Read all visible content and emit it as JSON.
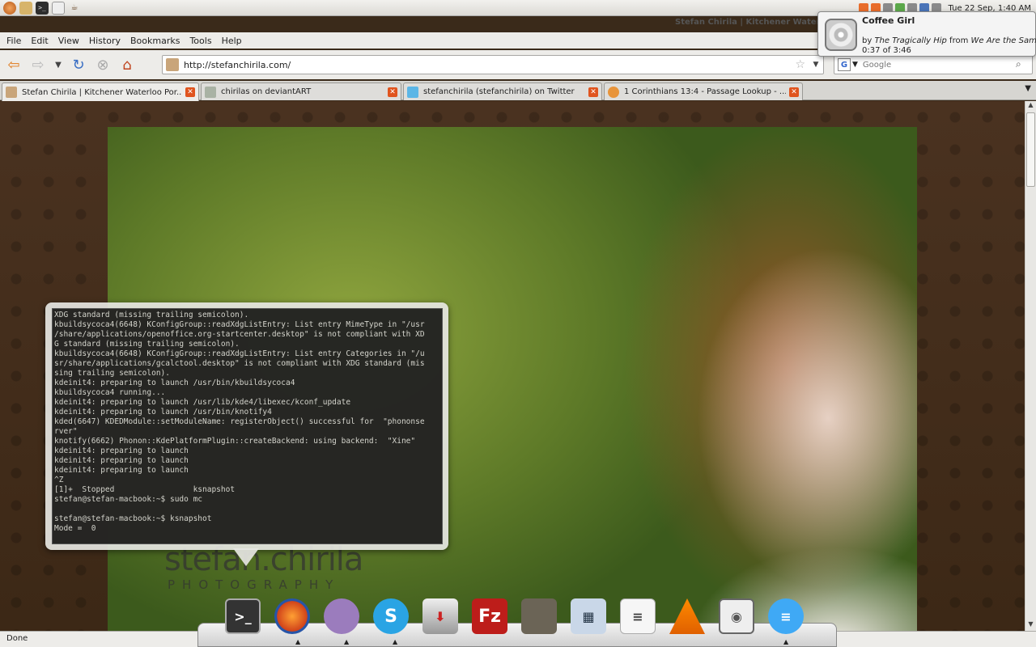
{
  "panel": {
    "launchers": [
      "ubuntu-icon",
      "folder-icon",
      "terminal-icon",
      "text-editor-icon",
      "coffee-icon"
    ],
    "window_title": "Stefan Chirila | Kitchener Waterloo",
    "clock": "Tue 22 Sep,  1:40 AM"
  },
  "notification": {
    "title": "Coffee Girl",
    "by_prefix": "by",
    "artist": "The Tragically Hip",
    "from_word": "from",
    "album": "We Are the Same",
    "progress": "0:37 of 3:46"
  },
  "menubar": {
    "items": [
      "File",
      "Edit",
      "View",
      "History",
      "Bookmarks",
      "Tools",
      "Help"
    ]
  },
  "navbar": {
    "url": "http://stefanchirila.com/",
    "search_placeholder": "Google",
    "search_engine_glyph": "G"
  },
  "tabs": [
    {
      "label": "Stefan Chirila | Kitchener Waterloo Por...",
      "active": true
    },
    {
      "label": "chirilas on deviantART",
      "active": false
    },
    {
      "label": "stefanchirila (stefanchirila) on Twitter",
      "active": false
    },
    {
      "label": "1 Corinthians 13:4 - Passage Lookup - ...",
      "active": false
    }
  ],
  "page": {
    "brand": "stefan.chirila",
    "brand_sub": "PHOTOGRAPHY"
  },
  "terminal": {
    "text": "XDG standard (missing trailing semicolon).\nkbuildsycoca4(6648) KConfigGroup::readXdgListEntry: List entry MimeType in \"/usr\n/share/applications/openoffice.org-startcenter.desktop\" is not compliant with XD\nG standard (missing trailing semicolon).\nkbuildsycoca4(6648) KConfigGroup::readXdgListEntry: List entry Categories in \"/u\nsr/share/applications/gcalctool.desktop\" is not compliant with XDG standard (mis\nsing trailing semicolon).\nkdeinit4: preparing to launch /usr/bin/kbuildsycoca4\nkbuildsycoca4 running...\nkdeinit4: preparing to launch /usr/lib/kde4/libexec/kconf_update\nkdeinit4: preparing to launch /usr/bin/knotify4\nkded(6647) KDEDModule::setModuleName: registerObject() successful for  \"phononse\nrver\"\nknotify(6662) Phonon::KdePlatformPlugin::createBackend: using backend:  \"Xine\"\nkdeinit4: preparing to launch\nkdeinit4: preparing to launch\nkdeinit4: preparing to launch\n^Z\n[1]+  Stopped                 ksnapshot\nstefan@stefan-macbook:~$ sudo mc\n\nstefan@stefan-macbook:~$ ksnapshot\nMode =  0"
  },
  "dock": {
    "apps": [
      "terminal-icon",
      "firefox-icon",
      "pidgin-icon",
      "skype-icon",
      "installer-icon",
      "filezilla-icon",
      "gimp-icon",
      "image-viewer-icon",
      "document-icon",
      "vlc-icon",
      "audio-player-icon",
      "chat-icon"
    ]
  },
  "status": {
    "text": "Done"
  },
  "colors": {
    "accent_orange": "#e0541e",
    "page_background": "#3c2816"
  }
}
